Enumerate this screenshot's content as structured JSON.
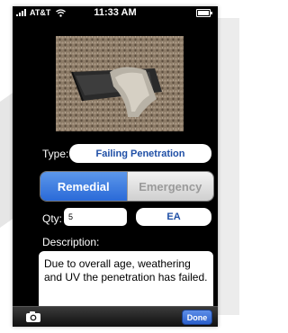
{
  "status_bar": {
    "carrier": "AT&T",
    "time": "11:33 AM"
  },
  "form": {
    "type_label": "Type:",
    "type_value": "Failing Penetration",
    "segments": [
      {
        "label": "Remedial",
        "selected": true
      },
      {
        "label": "Emergency",
        "selected": false
      }
    ],
    "qty_label": "Qty:",
    "qty_value": "5",
    "unit_value": "EA",
    "description_label": "Description:",
    "description_value": "Due to overall age, weathering and UV the penetration has failed."
  },
  "toolbar": {
    "camera_icon": "camera-icon",
    "done_label": "Done"
  },
  "colors": {
    "accent_blue": "#2a6ad8",
    "link_blue": "#1f4fa6",
    "screen_bg": "#000000"
  }
}
